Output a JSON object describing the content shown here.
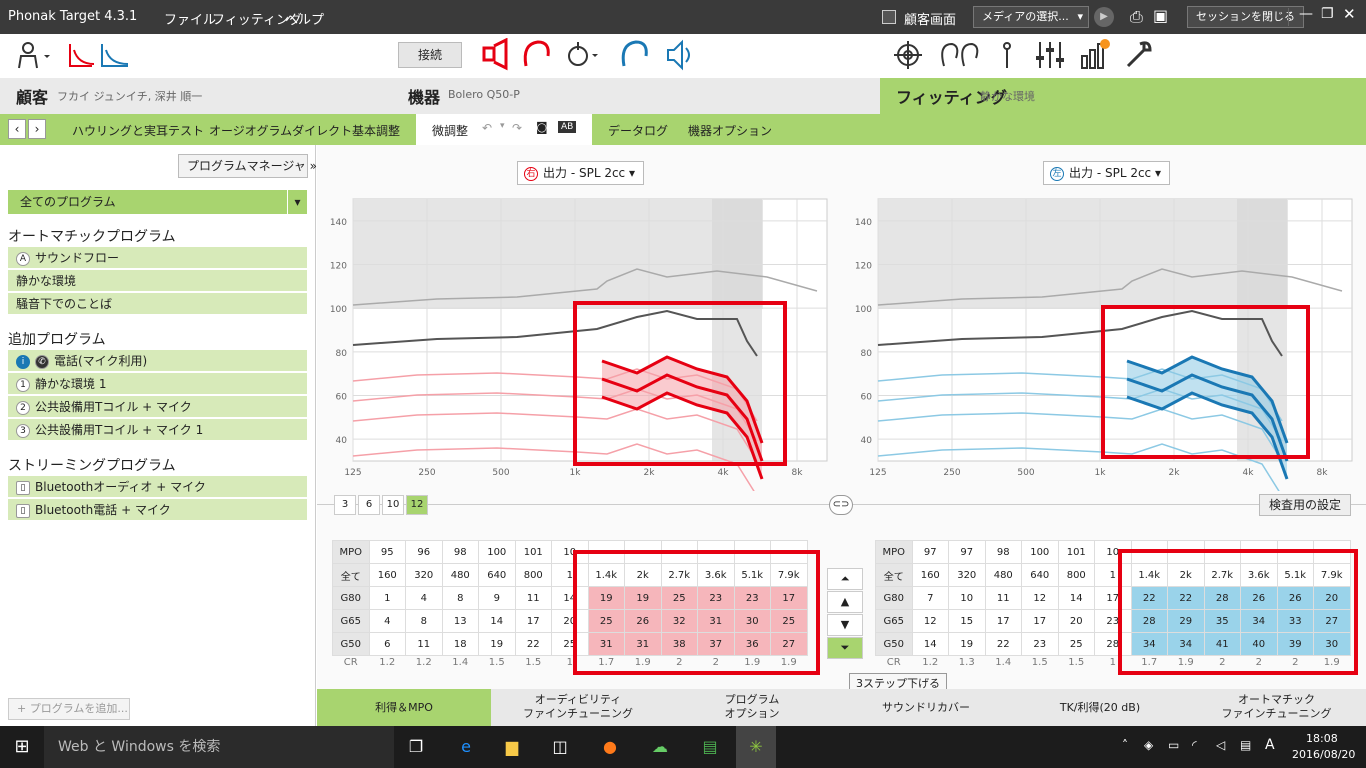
{
  "titlebar": {
    "app": "Phonak Target 4.3.1",
    "menus": [
      "ファイル",
      "フィッティング",
      "ヘルプ"
    ],
    "client_screen": "顧客画面",
    "media_select": "メディアの選択...",
    "close_session": "セッションを閉じる"
  },
  "toolbar": {
    "connect": "接続"
  },
  "sections": {
    "client": {
      "title": "顧客",
      "sub": "フカイ ジュンイチ, 深井 順一"
    },
    "device": {
      "title": "機器",
      "sub": "Bolero Q50-P"
    },
    "fitting": {
      "title": "フィッティング",
      "sub": "静かな環境"
    }
  },
  "tabs": [
    "ハウリングと実耳テスト",
    "オージオグラムダイレクト",
    "基本調整",
    "微調整",
    "データログ",
    "機器オプション"
  ],
  "ab_label": "AB",
  "sidebar": {
    "program_manager": "プログラムマネージャ",
    "all_programs": "全てのプログラム",
    "auto_title": "オートマチックプログラム",
    "auto_items": [
      {
        "badge": "A",
        "label": "サウンドフロー"
      },
      {
        "badge": "",
        "label": "静かな環境"
      },
      {
        "badge": "",
        "label": "騒音下でのことば"
      }
    ],
    "extra_title": "追加プログラム",
    "extra_items": [
      {
        "badge": "i",
        "label": "電話(マイク利用)"
      },
      {
        "badge": "1",
        "label": "静かな環境 1"
      },
      {
        "badge": "2",
        "label": "公共設備用Tコイル + マイク"
      },
      {
        "badge": "3",
        "label": "公共設備用Tコイル + マイク 1"
      }
    ],
    "stream_title": "ストリーミングプログラム",
    "stream_items": [
      {
        "badge": "",
        "label": "Bluetoothオーディオ + マイク"
      },
      {
        "badge": "",
        "label": "Bluetooth電話 + マイク"
      }
    ],
    "add_program": "+ プログラムを追加..."
  },
  "charts": {
    "right_selector": {
      "side": "右",
      "label": "出力 - SPL 2cc"
    },
    "left_selector": {
      "side": "左",
      "label": "出力 - SPL 2cc"
    },
    "y_ticks": [
      "140",
      "120",
      "100",
      "80",
      "60",
      "40"
    ],
    "x_ticks": [
      "125",
      "250",
      "500",
      "1k",
      "2k",
      "4k",
      "8k"
    ],
    "channel_buttons": [
      "3",
      "6",
      "10",
      "12"
    ],
    "test_settings": "検査用の設定"
  },
  "tables": {
    "right": {
      "mpo": [
        "MPO",
        "95",
        "96",
        "98",
        "100",
        "101",
        "10"
      ],
      "freq": [
        "全て",
        "160",
        "320",
        "480",
        "640",
        "800",
        "1",
        "1.4k",
        "2k",
        "2.7k",
        "3.6k",
        "5.1k",
        "7.9k"
      ],
      "g80": [
        "G80",
        "1",
        "4",
        "8",
        "9",
        "11",
        "14",
        "19",
        "19",
        "25",
        "23",
        "23",
        "17"
      ],
      "g65": [
        "G65",
        "4",
        "8",
        "13",
        "14",
        "17",
        "20",
        "25",
        "26",
        "32",
        "31",
        "30",
        "25"
      ],
      "g50": [
        "G50",
        "6",
        "11",
        "18",
        "19",
        "22",
        "25",
        "31",
        "31",
        "38",
        "37",
        "36",
        "27"
      ],
      "cr": [
        "CR",
        "1.2",
        "1.2",
        "1.4",
        "1.5",
        "1.5",
        "1",
        "1.7",
        "1.9",
        "2",
        "2",
        "1.9",
        "1.9"
      ]
    },
    "left": {
      "mpo": [
        "MPO",
        "97",
        "97",
        "98",
        "100",
        "101",
        "10"
      ],
      "freq": [
        "全て",
        "160",
        "320",
        "480",
        "640",
        "800",
        "1",
        "1.4k",
        "2k",
        "2.7k",
        "3.6k",
        "5.1k",
        "7.9k"
      ],
      "g80": [
        "G80",
        "7",
        "10",
        "11",
        "12",
        "14",
        "17",
        "22",
        "22",
        "28",
        "26",
        "26",
        "20"
      ],
      "g65": [
        "G65",
        "12",
        "15",
        "17",
        "17",
        "20",
        "23",
        "28",
        "29",
        "35",
        "34",
        "33",
        "27"
      ],
      "g50": [
        "G50",
        "14",
        "19",
        "22",
        "23",
        "25",
        "28",
        "34",
        "34",
        "41",
        "40",
        "39",
        "30"
      ],
      "cr": [
        "CR",
        "1.2",
        "1.3",
        "1.4",
        "1.5",
        "1.5",
        "1",
        "1.7",
        "1.9",
        "2",
        "2",
        "2",
        "1.9"
      ]
    },
    "tooltip": "3ステップ下げる"
  },
  "bottom_tabs": [
    "利得＆MPO",
    "オーディビリティ\nファインチューニング",
    "プログラム\nオプション",
    "サウンドリカバー",
    "TK/利得(20 dB)",
    "オートマチック\nファインチューニング"
  ],
  "taskbar": {
    "search": "Web と Windows を検索",
    "ime": "A",
    "time": "18:08",
    "date": "2016/08/20"
  },
  "colors": {
    "accent_green": "#a8d46f",
    "red": "#e60012",
    "blue": "#1a78b4",
    "red_cell": "#f6b6bb",
    "blue_cell": "#9ad3ea"
  }
}
